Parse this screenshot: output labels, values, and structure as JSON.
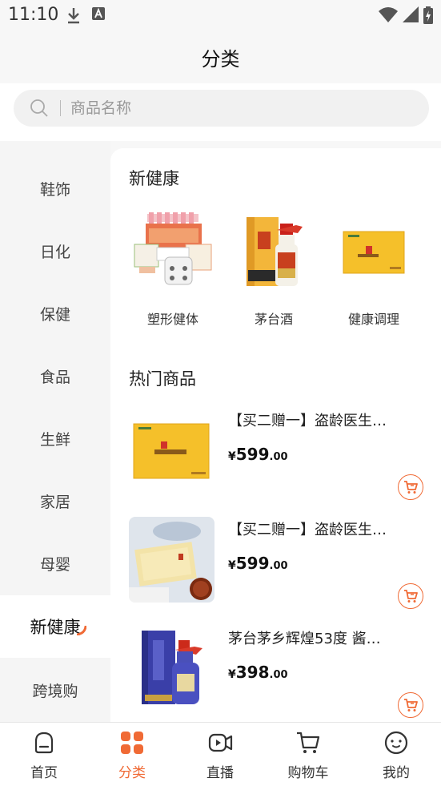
{
  "status_bar": {
    "time": "11:10"
  },
  "header": {
    "title": "分类"
  },
  "search": {
    "placeholder": "商品名称"
  },
  "sidebar": {
    "items": [
      {
        "label": "鞋饰"
      },
      {
        "label": "日化"
      },
      {
        "label": "保健"
      },
      {
        "label": "食品"
      },
      {
        "label": "生鲜"
      },
      {
        "label": "家居"
      },
      {
        "label": "母婴"
      },
      {
        "label": "新健康"
      },
      {
        "label": "跨境购"
      }
    ],
    "active_index": 7
  },
  "content": {
    "category_title": "新健康",
    "categories": [
      {
        "label": "塑形健体"
      },
      {
        "label": "茅台酒"
      },
      {
        "label": "健康调理"
      }
    ],
    "hot_title": "热门商品",
    "products": [
      {
        "name": "【买二赠一】盗龄医生…",
        "currency": "¥",
        "price_int": "599",
        "price_dec": ".00"
      },
      {
        "name": "【买二赠一】盗龄医生…",
        "currency": "¥",
        "price_int": "599",
        "price_dec": ".00"
      },
      {
        "name": "茅台茅乡辉煌53度 酱…",
        "currency": "¥",
        "price_int": "398",
        "price_dec": ".00"
      }
    ]
  },
  "tabbar": {
    "items": [
      {
        "label": "首页",
        "icon": "home-icon"
      },
      {
        "label": "分类",
        "icon": "category-icon"
      },
      {
        "label": "直播",
        "icon": "live-icon"
      },
      {
        "label": "购物车",
        "icon": "cart-icon"
      },
      {
        "label": "我的",
        "icon": "profile-icon"
      }
    ],
    "active_index": 1
  },
  "colors": {
    "accent": "#f06a35",
    "background": "#f7f7f7",
    "sidebar": "#f5f5f5"
  }
}
